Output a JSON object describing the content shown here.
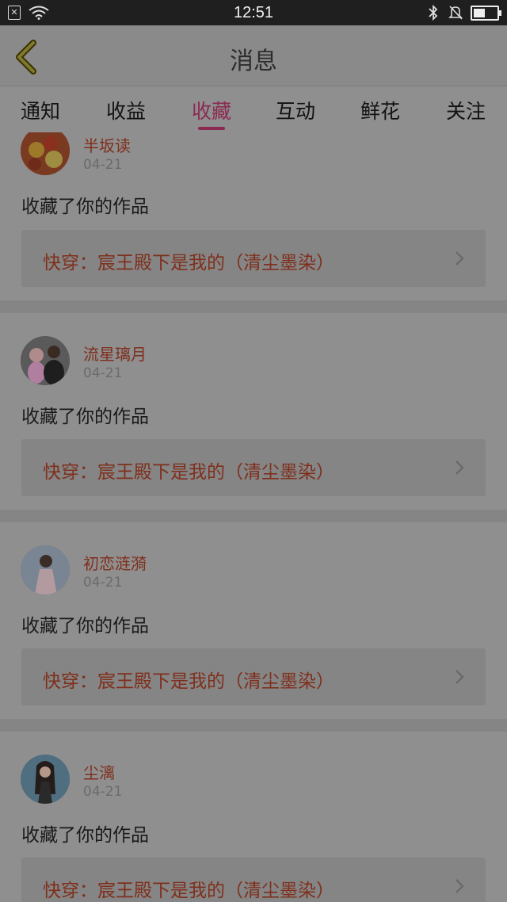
{
  "status_bar": {
    "time": "12:51",
    "notification_icon_glyph": "✕",
    "battery_level": 0.5
  },
  "header": {
    "title": "消息"
  },
  "tabs": [
    {
      "label": "通知"
    },
    {
      "label": "收益"
    },
    {
      "label": "收藏"
    },
    {
      "label": "互动"
    },
    {
      "label": "鲜花"
    },
    {
      "label": "关注"
    }
  ],
  "active_tab": "收藏",
  "colors": {
    "accent": "#8b2a52",
    "name_text": "#7f2f1c"
  },
  "feed": [
    {
      "name": "半坂读",
      "date": "04-21",
      "action": "收藏了你的作品",
      "work_title": "快穿：宸王殿下是我的（清尘墨染）"
    },
    {
      "name": "流星璃月",
      "date": "04-21",
      "action": "收藏了你的作品",
      "work_title": "快穿：宸王殿下是我的（清尘墨染）"
    },
    {
      "name": "初恋涟漪",
      "date": "04-21",
      "action": "收藏了你的作品",
      "work_title": "快穿：宸王殿下是我的（清尘墨染）"
    },
    {
      "name": "尘漓",
      "date": "04-21",
      "action": "收藏了你的作品",
      "work_title": "快穿：宸王殿下是我的（清尘墨染）"
    }
  ]
}
